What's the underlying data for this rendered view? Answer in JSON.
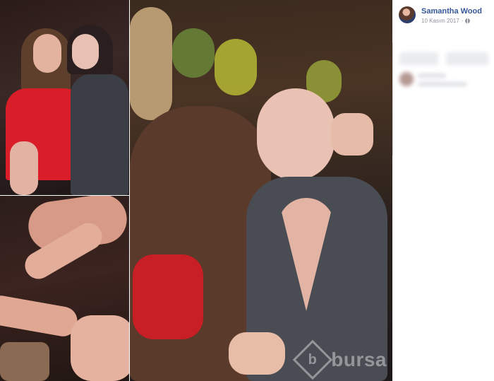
{
  "post": {
    "author": "Samantha Wood",
    "date": "10 Kasım 2017",
    "separator": "·",
    "privacy_icon": "globe-icon",
    "avatar_icon": "avatar"
  },
  "watermark": {
    "badge": "b",
    "text": "bursa"
  },
  "colors": {
    "author_link": "#365899",
    "meta_text": "#90949c"
  }
}
